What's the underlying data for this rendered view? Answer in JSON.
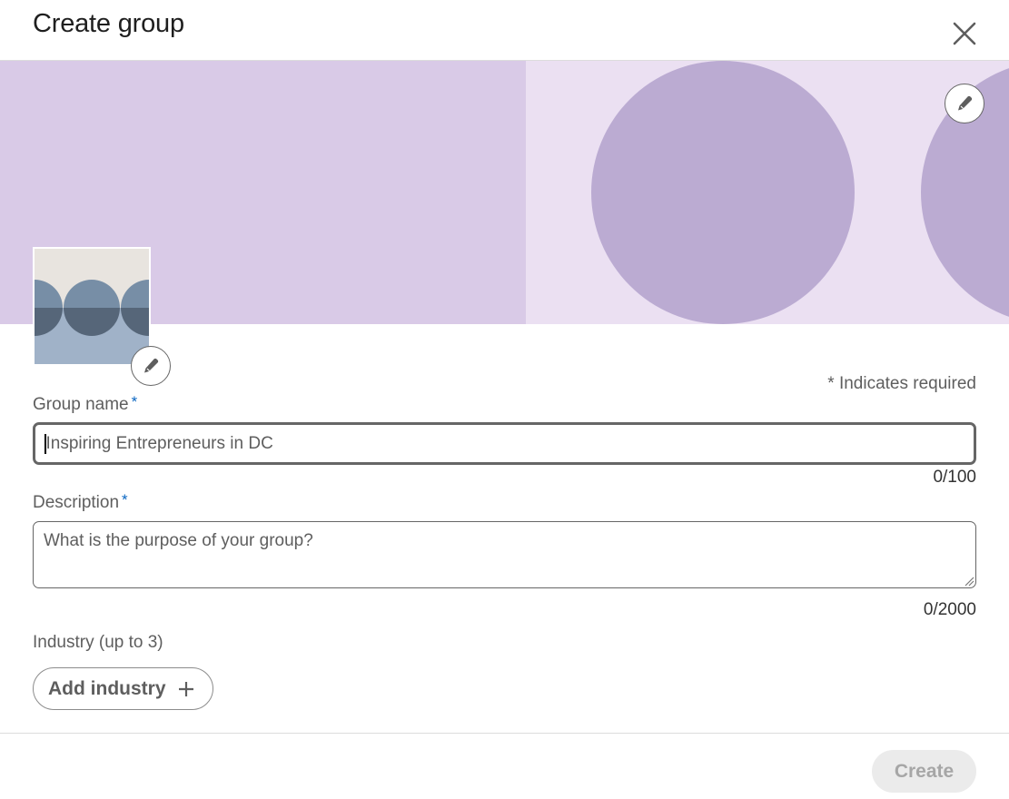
{
  "dialog": {
    "title": "Create group",
    "close_icon": "close-icon"
  },
  "banner": {
    "colors": {
      "left": "#d9cae7",
      "right": "#ebe0f2",
      "circles": "#bbabd2"
    },
    "edit_icon": "pencil-icon"
  },
  "logo": {
    "colors": {
      "top": "#e8e4df",
      "circle_light": "#778ea6",
      "circle_dark": "#566679",
      "bottom": "#a0b2c8"
    },
    "edit_icon": "pencil-icon"
  },
  "form": {
    "required_note": "* Indicates required",
    "group_name": {
      "label": "Group name",
      "required_mark": "*",
      "value": "",
      "placeholder": "Inspiring Entrepreneurs in DC",
      "counter": "0/100"
    },
    "description": {
      "label": "Description",
      "required_mark": "*",
      "value": "",
      "placeholder": "What is the purpose of your group?",
      "counter": "0/2000"
    },
    "industry": {
      "label": "Industry (up to 3)",
      "add_button_label": "Add industry",
      "add_icon": "plus-icon"
    }
  },
  "footer": {
    "create_label": "Create",
    "create_disabled": true
  },
  "accent_color": "#0a66c2"
}
